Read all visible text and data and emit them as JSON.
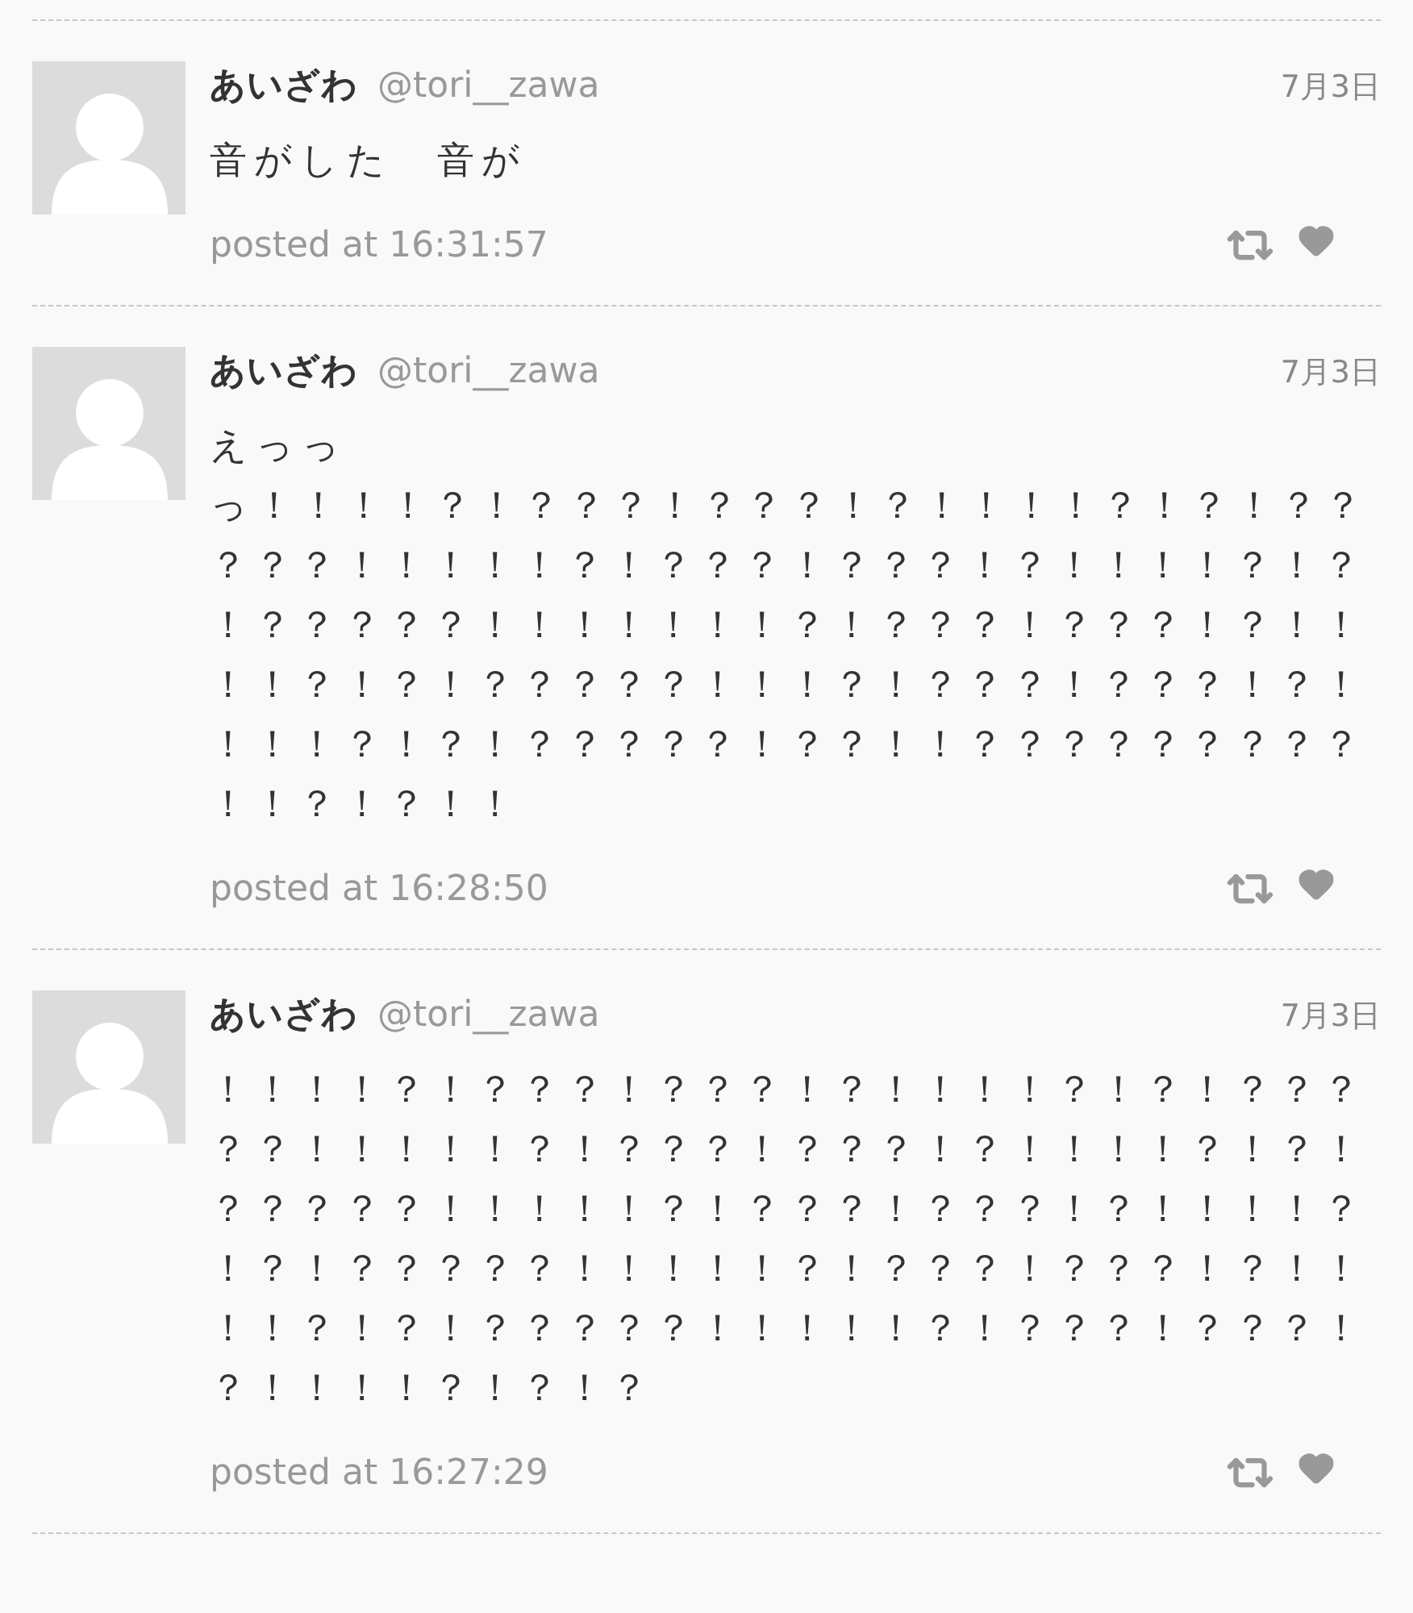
{
  "posts": [
    {
      "name": "あいざわ",
      "handle": "@tori__zawa",
      "date": "7月3日",
      "body_lines": [
        "音がした　音が"
      ],
      "posted": "posted at 16:31:57"
    },
    {
      "name": "あいざわ",
      "handle": "@tori__zawa",
      "date": "7月3日",
      "body_lines": [
        "えっっ",
        "っ！！！！？！？？？！？？？！？！！！！？！？！？？",
        "？？？！！！！！？！？？？！？？？！？！！！！？！？",
        "！？？？？？！！！！！！！？！？？？！？？？！？！！",
        "！！？！？！？？？？？！！！？！？？？！？？？！？！",
        "！！！？！？！？？？？？！？？！！？？？？？？？？？",
        "！！？！？！！"
      ],
      "posted": "posted at 16:28:50"
    },
    {
      "name": "あいざわ",
      "handle": "@tori__zawa",
      "date": "7月3日",
      "body_lines": [
        "！！！！？！？？？！？？？！？！！！！？！？！？？？",
        "？？！！！！！？！？？？！？？？！？！！！！？！？！",
        "？？？？？！！！！！？！？？？！？？？！？！！！！？",
        "！？！？？？？？！！！！！？！？？？！？？？！？！！",
        "！！？！？！？？？？？！！！！！？！？？？！？？？！",
        "？！！！！？！？！？"
      ],
      "posted": "posted at 16:27:29"
    }
  ]
}
